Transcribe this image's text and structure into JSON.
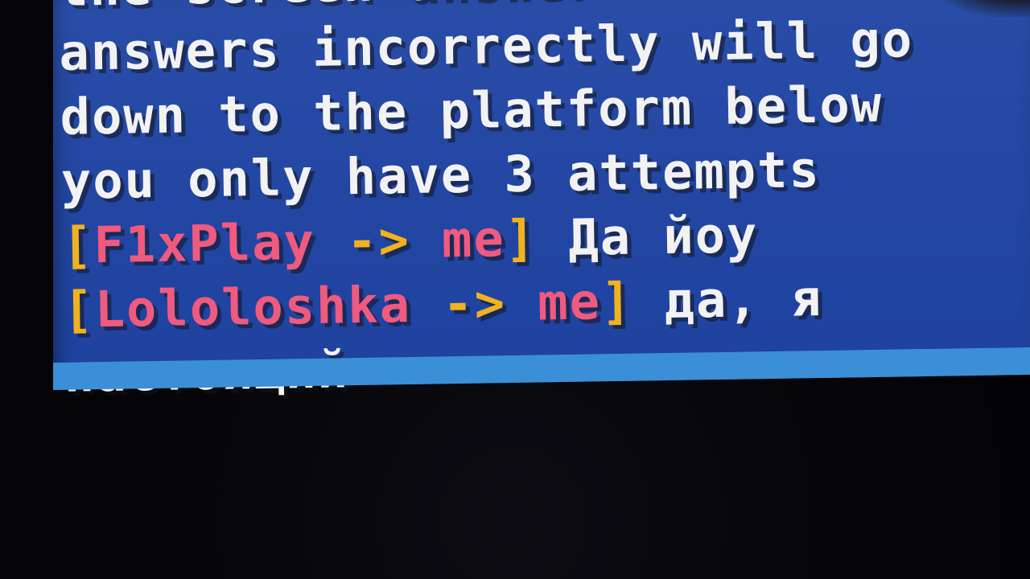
{
  "chat": {
    "line1": "the screen  answer",
    "line2": "answers incorrectly will go",
    "line3": "down to the platform below",
    "line4": "you only have 3 attempts",
    "msg1": {
      "open_bracket": "[",
      "sender": "F1xPlay",
      "arrow": " -> ",
      "recipient": "me",
      "close_bracket": "]",
      "text": " Да йоу"
    },
    "msg2": {
      "open_bracket": "[",
      "sender": "Lololoshka",
      "arrow": " -> ",
      "recipient": "me",
      "close_bracket": "]",
      "text": " да, я"
    },
    "msg2_cont": "настоящий"
  },
  "colors": {
    "chat_background": "#2246a2",
    "hotbar_strip": "#3b8fd6",
    "text_white": "#f2f2f2",
    "name_pink": "#f05a7e",
    "bracket_gold": "#f2b21e"
  }
}
